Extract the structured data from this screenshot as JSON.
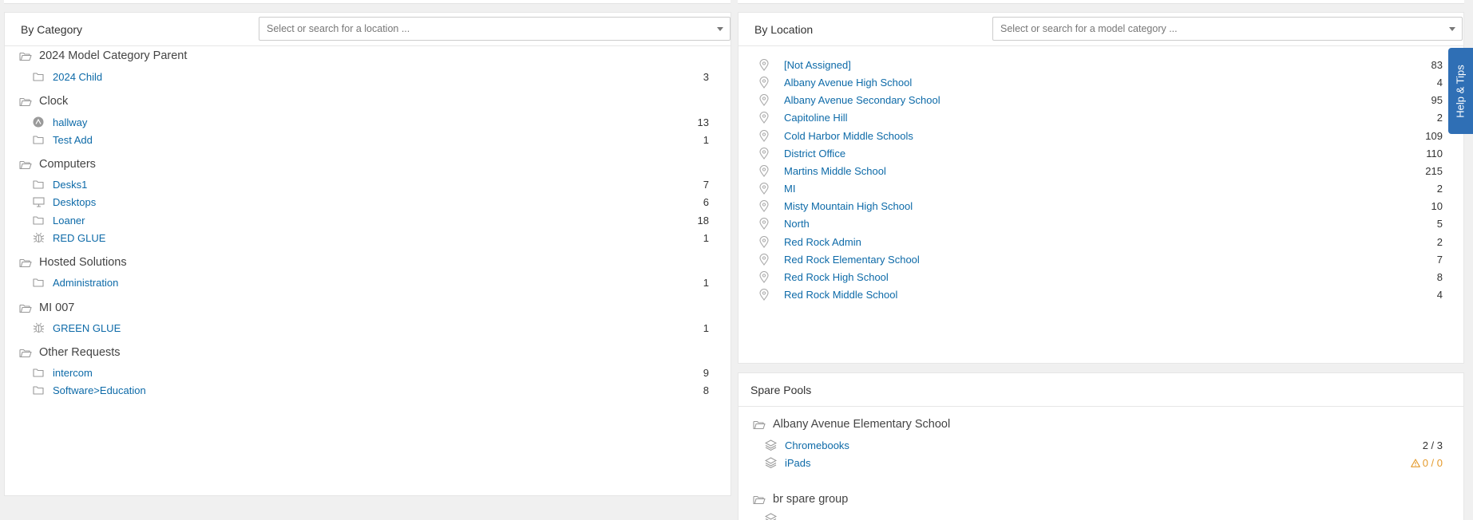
{
  "by_category": {
    "title": "By Category",
    "search_placeholder": "Select or search for a location ...",
    "groups": [
      {
        "label": "2024 Model Category Parent",
        "items": [
          {
            "label": "2024 Child",
            "count": "3",
            "icon": "folder-icon"
          }
        ]
      },
      {
        "label": "Clock",
        "items": [
          {
            "label": "hallway",
            "count": "13",
            "icon": "circle-user-icon"
          },
          {
            "label": "Test Add",
            "count": "1",
            "icon": "folder-icon"
          }
        ]
      },
      {
        "label": "Computers",
        "items": [
          {
            "label": "Desks1",
            "count": "7",
            "icon": "folder-icon"
          },
          {
            "label": "Desktops",
            "count": "6",
            "icon": "desktop-icon"
          },
          {
            "label": "Loaner",
            "count": "18",
            "icon": "folder-icon"
          },
          {
            "label": "RED GLUE",
            "count": "1",
            "icon": "bug-icon"
          }
        ]
      },
      {
        "label": "Hosted Solutions",
        "items": [
          {
            "label": "Administration",
            "count": "1",
            "icon": "folder-icon"
          }
        ]
      },
      {
        "label": "MI 007",
        "items": [
          {
            "label": "GREEN GLUE",
            "count": "1",
            "icon": "bug-icon"
          }
        ]
      },
      {
        "label": "Other Requests",
        "items": [
          {
            "label": "intercom",
            "count": "9",
            "icon": "folder-icon"
          },
          {
            "label": "Software>Education",
            "count": "8",
            "icon": "folder-icon"
          }
        ]
      }
    ]
  },
  "by_location": {
    "title": "By Location",
    "search_placeholder": "Select or search for a model category ...",
    "items": [
      {
        "label": "[Not Assigned]",
        "count": "83"
      },
      {
        "label": "Albany Avenue High School",
        "count": "4"
      },
      {
        "label": "Albany Avenue Secondary School",
        "count": "95"
      },
      {
        "label": "Capitoline Hill",
        "count": "2"
      },
      {
        "label": "Cold Harbor Middle Schools",
        "count": "109"
      },
      {
        "label": "District Office",
        "count": "110"
      },
      {
        "label": "Martins Middle School",
        "count": "215"
      },
      {
        "label": "MI",
        "count": "2"
      },
      {
        "label": "Misty Mountain High School",
        "count": "10"
      },
      {
        "label": "North",
        "count": "5"
      },
      {
        "label": "Red Rock Admin",
        "count": "2"
      },
      {
        "label": "Red Rock Elementary School",
        "count": "7"
      },
      {
        "label": "Red Rock High School",
        "count": "8"
      },
      {
        "label": "Red Rock Middle School",
        "count": "4"
      }
    ]
  },
  "spare_pools": {
    "title": "Spare Pools",
    "groups": [
      {
        "label": "Albany Avenue Elementary School",
        "items": [
          {
            "label": "Chromebooks",
            "count": "2 / 3",
            "warning": false
          },
          {
            "label": "iPads",
            "count": "0 / 0",
            "warning": true
          }
        ]
      },
      {
        "label": "br spare group",
        "items": []
      }
    ]
  },
  "help_tab": {
    "label": "Help & Tips"
  },
  "colors": {
    "link": "#0d6aa8",
    "accent": "#2f6fb5",
    "warning": "#e49a2b"
  }
}
